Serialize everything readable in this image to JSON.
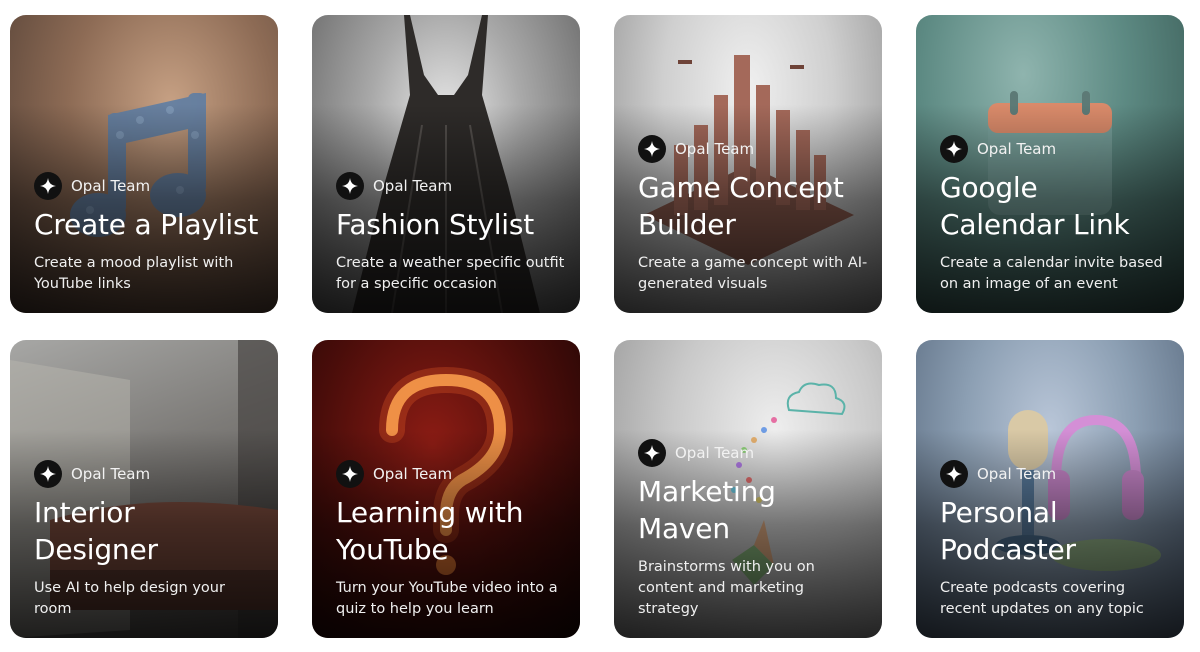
{
  "cards": [
    {
      "author": "Opal Team",
      "title": "Create a Playlist",
      "description": "Create a mood playlist with YouTube links",
      "art_icon": "music-note-icon"
    },
    {
      "author": "Opal Team",
      "title": "Fashion Stylist",
      "description": "Create a weather specific outfit for a specific occasion",
      "art_icon": "dress-icon"
    },
    {
      "author": "Opal Team",
      "title": "Game Concept Builder",
      "description": "Create a game concept with AI-generated visuals",
      "art_icon": "city-icon"
    },
    {
      "author": "Opal Team",
      "title": "Google Calendar Link",
      "description": "Create a calendar invite based on an image of an event",
      "art_icon": "calendar-icon"
    },
    {
      "author": "Opal Team",
      "title": "Interior Designer",
      "description": "Use AI to help design your room",
      "art_icon": "sofa-icon"
    },
    {
      "author": "Opal Team",
      "title": "Learning with YouTube",
      "description": "Turn your YouTube video into a quiz to help you learn",
      "art_icon": "question-mark-icon"
    },
    {
      "author": "Opal Team",
      "title": "Marketing Maven",
      "description": "Brainstorms with you on content and marketing strategy",
      "art_icon": "idea-cloud-icon"
    },
    {
      "author": "Opal Team",
      "title": "Personal Podcaster",
      "description": "Create podcasts covering recent updates on any topic",
      "art_icon": "microphone-headphones-icon"
    }
  ],
  "icons": {
    "author_logo": "sparkle-icon"
  },
  "colors": {
    "text": "#ffffff",
    "logo_bg": "#111111"
  }
}
